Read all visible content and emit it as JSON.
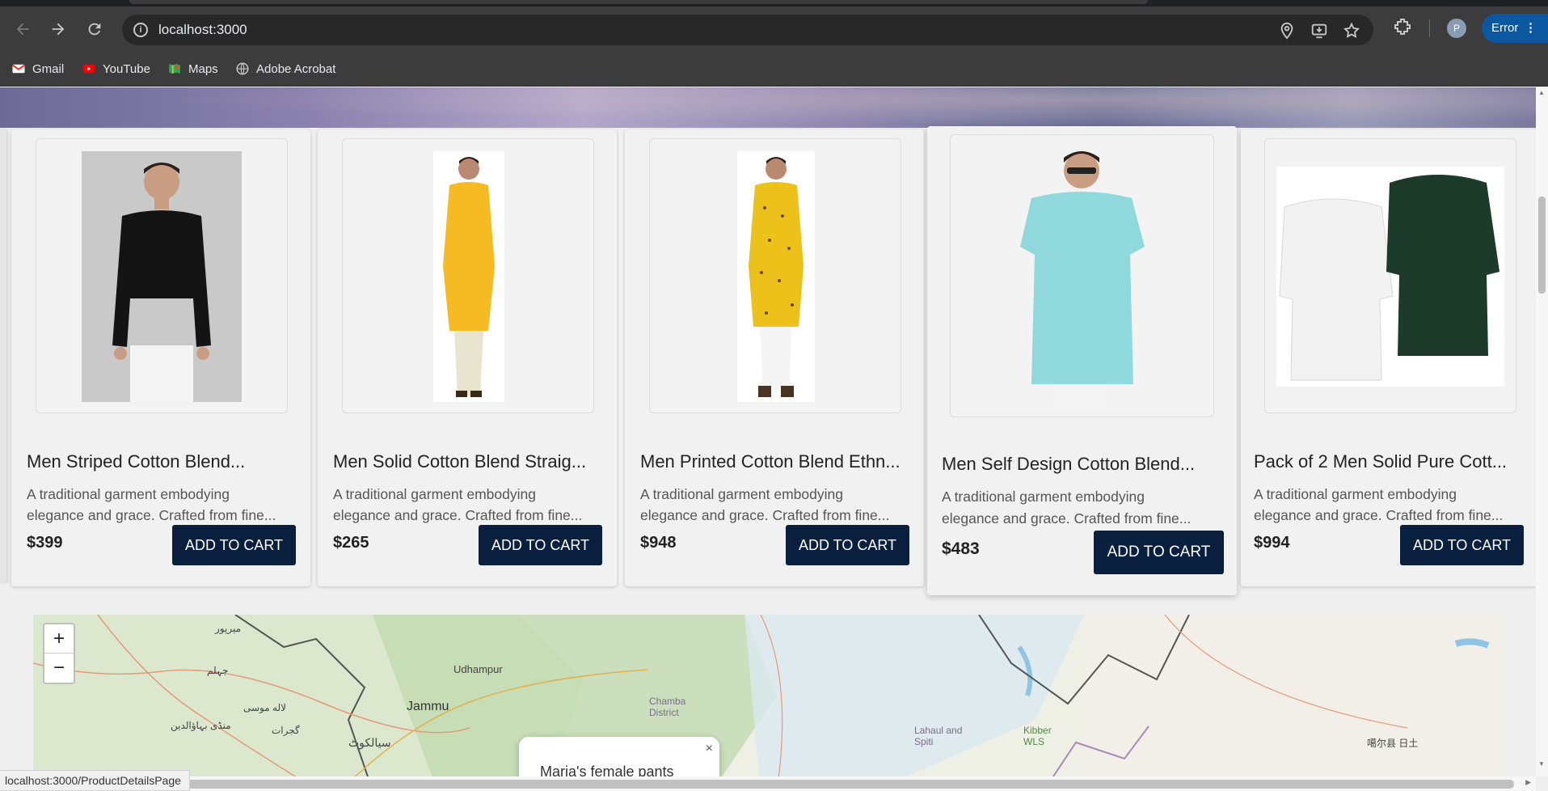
{
  "browser": {
    "url": "localhost:3000",
    "profile_initial": "P",
    "error_label": "Error",
    "bookmarks": [
      {
        "label": "Gmail",
        "icon": "gmail-icon"
      },
      {
        "label": "YouTube",
        "icon": "youtube-icon"
      },
      {
        "label": "Maps",
        "icon": "maps-icon"
      },
      {
        "label": "Adobe Acrobat",
        "icon": "globe-icon"
      }
    ],
    "status_url": "localhost:3000/ProductDetailsPage"
  },
  "products": [
    {
      "title": "Men Striped Cotton Blend...",
      "desc_line1": "A traditional garment embodying",
      "desc_line2": "elegance and grace. Crafted from fine...",
      "price": "$399",
      "cta": "ADD TO CART"
    },
    {
      "title": "Men Solid Cotton Blend Straig...",
      "desc_line1": "A traditional garment embodying",
      "desc_line2": "elegance and grace. Crafted from fine...",
      "price": "$265",
      "cta": "ADD TO CART"
    },
    {
      "title": "Men Printed Cotton Blend Ethn...",
      "desc_line1": "A traditional garment embodying",
      "desc_line2": "elegance and grace. Crafted from fine...",
      "price": "$948",
      "cta": "ADD TO CART"
    },
    {
      "title": "Men Self Design Cotton Blend...",
      "desc_line1": "A traditional garment embodying",
      "desc_line2": "elegance and grace. Crafted from fine...",
      "price": "$483",
      "cta": "ADD TO CART"
    },
    {
      "title": "Pack of 2 Men Solid Pure Cott...",
      "desc_line1": "A traditional garment embodying",
      "desc_line2": "elegance and grace. Crafted from fine...",
      "price": "$994",
      "cta": "ADD TO CART"
    }
  ],
  "map": {
    "zoom_in": "+",
    "zoom_out": "−",
    "labels": [
      "میرپور",
      "جہلم",
      "Udhampur",
      "Jammu",
      "Chamba District",
      "لاله موسی",
      "منڈی بہاؤالدین",
      "گجرات",
      "سیالکوٹ",
      "Lahaul and Spiti",
      "Kibber WLS",
      "噶尔县 日土"
    ],
    "popup_text": "Maria's female pants",
    "popup_close": "×"
  },
  "colors": {
    "cta_bg": "#0a1f3d",
    "page_bg": "#efefef",
    "chrome_bg": "#3c3c3c"
  }
}
